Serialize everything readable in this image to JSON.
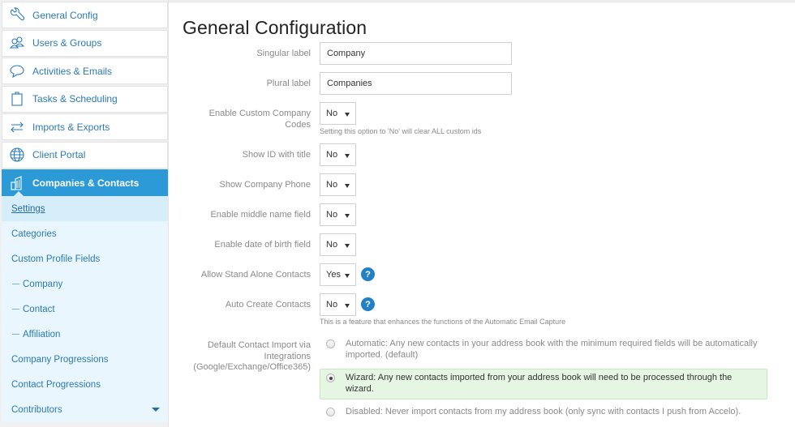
{
  "sidebar": {
    "items": [
      {
        "label": "General Config",
        "icon": "wrench-icon"
      },
      {
        "label": "Users & Groups",
        "icon": "users-icon"
      },
      {
        "label": "Activities & Emails",
        "icon": "chat-bubble-icon"
      },
      {
        "label": "Tasks & Scheduling",
        "icon": "clipboard-icon"
      },
      {
        "label": "Imports & Exports",
        "icon": "swap-arrows-icon"
      },
      {
        "label": "Client Portal",
        "icon": "globe-icon"
      },
      {
        "label": "Companies & Contacts",
        "icon": "buildings-icon",
        "active": true
      }
    ],
    "subitems": [
      {
        "label": "Settings",
        "selected": true
      },
      {
        "label": "Categories"
      },
      {
        "label": "Custom Profile Fields"
      },
      {
        "label": "Company",
        "indent": true
      },
      {
        "label": "Contact",
        "indent": true
      },
      {
        "label": "Affiliation",
        "indent": true
      },
      {
        "label": "Company Progressions"
      },
      {
        "label": "Contact Progressions"
      },
      {
        "label": "Contributors",
        "expandable": true
      }
    ]
  },
  "main": {
    "title": "General Configuration",
    "fields": {
      "singular_label": {
        "label": "Singular label",
        "value": "Company"
      },
      "plural_label": {
        "label": "Plural label",
        "value": "Companies"
      },
      "custom_codes": {
        "label": "Enable Custom Company Codes",
        "value": "No",
        "hint": "Setting this option to 'No' will clear ALL custom ids"
      },
      "show_id": {
        "label": "Show ID with title",
        "value": "No"
      },
      "show_phone": {
        "label": "Show Company Phone",
        "value": "No"
      },
      "middle_name": {
        "label": "Enable middle name field",
        "value": "No"
      },
      "dob": {
        "label": "Enable date of birth field",
        "value": "No"
      },
      "stand_alone": {
        "label": "Allow Stand Alone Contacts",
        "value": "Yes"
      },
      "auto_create": {
        "label": "Auto Create Contacts",
        "value": "No",
        "hint": "This is a feature that enhances the functions of the Automatic Email Capture"
      },
      "import": {
        "label": "Default Contact Import via Integrations (Google/Exchange/Office365)",
        "options": [
          {
            "label": "Automatic: Any new contacts in your address book with the minimum required fields will be automatically imported. (default)",
            "checked": false
          },
          {
            "label": "Wizard: Any new contacts imported from your address book will need to be processed through the wizard.",
            "checked": true
          },
          {
            "label": "Disabled: Never import contacts from my address book (only sync with contacts I push from Accelo).",
            "checked": false
          }
        ]
      }
    },
    "help_glyph": "?"
  },
  "colors": {
    "accent": "#2b9ad6",
    "link": "#2a7ab8",
    "selected_option_bg": "#e5f6e2",
    "help_icon": "#2281c4"
  }
}
